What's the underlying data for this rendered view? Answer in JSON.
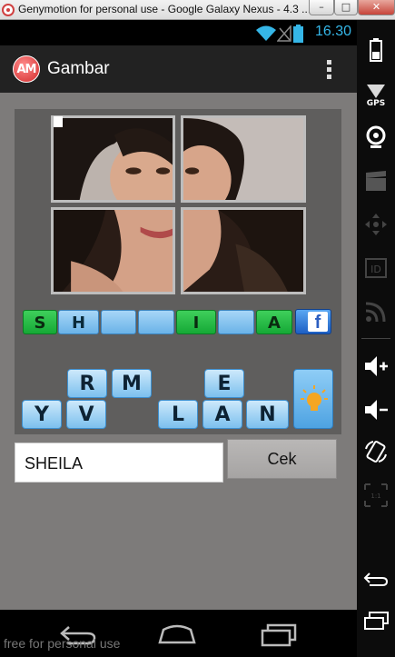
{
  "window": {
    "title": "Genymotion for personal use - Google Galaxy Nexus - 4.3 ..."
  },
  "status_bar": {
    "time": "16.30",
    "accent_color": "#35b6e7"
  },
  "action_bar": {
    "logo_text": "AM",
    "title": "Gambar"
  },
  "puzzle": {
    "answer_slots": [
      {
        "letter": "S",
        "state": "filled"
      },
      {
        "letter": "H",
        "state": "revealed"
      },
      {
        "letter": "",
        "state": "empty"
      },
      {
        "letter": "",
        "state": "empty"
      },
      {
        "letter": "I",
        "state": "filled"
      },
      {
        "letter": "",
        "state": "empty"
      },
      {
        "letter": "A",
        "state": "filled"
      }
    ],
    "letter_tiles": [
      "R",
      "M",
      "E",
      "Y",
      "V",
      "L",
      "A",
      "N"
    ]
  },
  "answer": {
    "value": "SHEILA",
    "submit_label": "Cek"
  },
  "watermark": "free for personal use",
  "colors": {
    "slot_green": "#15a936",
    "slot_blue": "#6ab3e8",
    "tile_blue": "#7cc0ee",
    "panel_gray": "#5f5e5d",
    "content_gray": "#7d7b7a"
  }
}
